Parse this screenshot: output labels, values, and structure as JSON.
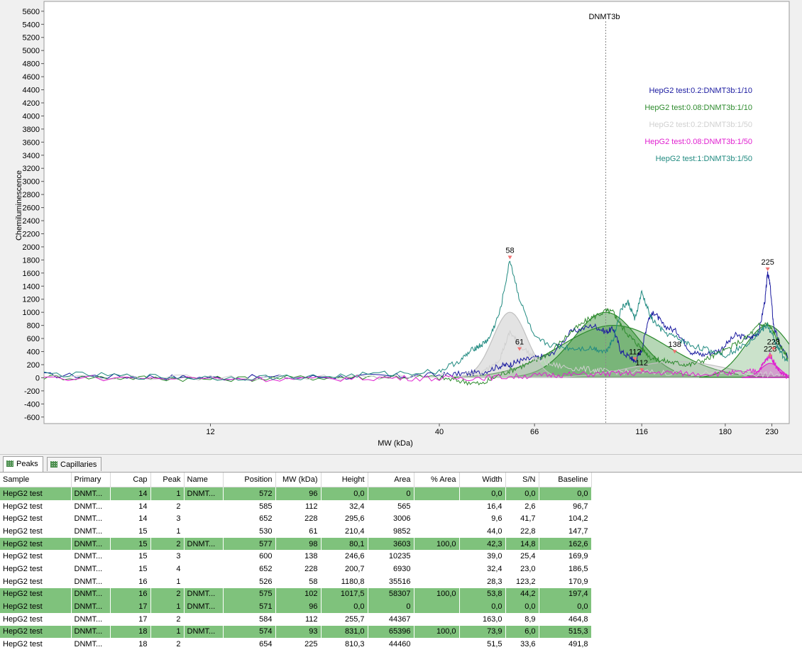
{
  "chart_data": {
    "type": "line",
    "xlabel": "MW (kDa)",
    "ylabel": "Chemiluminescence",
    "x_scale": "log",
    "ylim": [
      -700,
      5750
    ],
    "x_ticks": [
      12,
      40,
      66,
      116,
      180,
      230
    ],
    "y_ticks": [
      -600,
      -400,
      -200,
      0,
      200,
      400,
      600,
      800,
      1000,
      1200,
      1400,
      1600,
      1800,
      2000,
      2200,
      2400,
      2600,
      2800,
      3000,
      3200,
      3400,
      3600,
      3800,
      4000,
      4200,
      4400,
      4600,
      4800,
      5000,
      5200,
      5400,
      5600
    ],
    "marker": {
      "label": "DNMT3b",
      "x": 96
    },
    "legend_position": "right",
    "series": [
      {
        "name": "HepG2 test:0.2:DNMT3b:1/10",
        "color": "#1a1aa0",
        "x": [
          5,
          8,
          12,
          20,
          30,
          40,
          45,
          50,
          55,
          58,
          61,
          66,
          72,
          80,
          90,
          96,
          100,
          104,
          110,
          112,
          116,
          120,
          124,
          130,
          140,
          150,
          160,
          175,
          190,
          205,
          215,
          222,
          225,
          228,
          232,
          240,
          250
        ],
        "y": [
          40,
          20,
          0,
          10,
          20,
          40,
          60,
          80,
          180,
          200,
          260,
          300,
          350,
          700,
          800,
          700,
          750,
          400,
          300,
          250,
          420,
          900,
          1000,
          800,
          700,
          400,
          350,
          420,
          650,
          600,
          700,
          1200,
          1620,
          1400,
          800,
          500,
          300
        ]
      },
      {
        "name": "HepG2 test:0.08:DNMT3b:1/10",
        "color": "#2e8b2e",
        "x": [
          5,
          8,
          12,
          20,
          30,
          40,
          45,
          50,
          55,
          60,
          66,
          72,
          80,
          88,
          96,
          100,
          104,
          110,
          116,
          122,
          130,
          140,
          150,
          165,
          180,
          200,
          215,
          225,
          232,
          240,
          250
        ],
        "y": [
          10,
          0,
          -20,
          0,
          20,
          0,
          -50,
          -100,
          50,
          150,
          250,
          400,
          700,
          900,
          1020,
          1000,
          800,
          600,
          450,
          300,
          260,
          220,
          200,
          300,
          420,
          600,
          800,
          820,
          700,
          500,
          300
        ]
      },
      {
        "name": "HepG2 test:0.2:DNMT3b:1/50",
        "color": "#d0d0d0",
        "x": [
          5,
          12,
          20,
          30,
          40,
          50,
          55,
          58,
          61,
          66,
          72,
          80,
          90,
          96,
          110,
          130,
          160,
          200,
          225,
          250
        ],
        "y": [
          20,
          0,
          10,
          0,
          30,
          60,
          300,
          700,
          500,
          300,
          200,
          150,
          120,
          100,
          90,
          80,
          70,
          60,
          50,
          40
        ]
      },
      {
        "name": "HepG2 test:0.08:DNMT3b:1/50",
        "color": "#e020d0",
        "x": [
          5,
          12,
          20,
          30,
          40,
          50,
          60,
          70,
          80,
          96,
          110,
          130,
          150,
          180,
          200,
          215,
          222,
          228,
          234,
          242,
          250
        ],
        "y": [
          0,
          -10,
          -20,
          0,
          -10,
          0,
          20,
          40,
          50,
          60,
          70,
          80,
          60,
          70,
          80,
          120,
          250,
          350,
          200,
          60,
          20
        ]
      },
      {
        "name": "HepG2 test:1:DNMT3b:1/50",
        "color": "#208a80",
        "x": [
          5,
          8,
          12,
          20,
          30,
          40,
          45,
          48,
          50,
          52,
          55,
          58,
          61,
          66,
          72,
          80,
          90,
          96,
          100,
          104,
          108,
          112,
          116,
          122,
          130,
          140,
          150,
          165,
          180,
          200,
          215,
          225,
          232,
          240,
          250
        ],
        "y": [
          60,
          20,
          0,
          10,
          60,
          100,
          280,
          450,
          500,
          600,
          1000,
          1800,
          1200,
          600,
          500,
          450,
          450,
          400,
          600,
          1050,
          1150,
          900,
          1300,
          900,
          700,
          600,
          500,
          420,
          350,
          500,
          700,
          800,
          600,
          400,
          250
        ]
      }
    ],
    "peaks": [
      {
        "label": "58",
        "x": 58,
        "y": 1800
      },
      {
        "label": "61",
        "x": 61,
        "y": 400
      },
      {
        "label": "112",
        "x": 112,
        "y": 250
      },
      {
        "label": "112",
        "x": 116,
        "y": 80
      },
      {
        "label": "138",
        "x": 138,
        "y": 360
      },
      {
        "label": "225",
        "x": 225,
        "y": 1620
      },
      {
        "label": "228",
        "x": 228,
        "y": 290
      },
      {
        "label": "228",
        "x": 232,
        "y": 400
      }
    ],
    "fills": [
      {
        "color": "#2e8b2e",
        "opacity": 0.45,
        "center": 96,
        "height": 1000,
        "sigma": 0.17
      },
      {
        "color": "#2e8b2e",
        "opacity": 0.35,
        "center": 100,
        "height": 800,
        "sigma": 0.28
      },
      {
        "color": "#c0c0c0",
        "opacity": 0.45,
        "center": 58,
        "height": 1000,
        "sigma": 0.09
      },
      {
        "color": "#c0c0c0",
        "opacity": 0.35,
        "center": 140,
        "height": 250,
        "sigma": 0.25
      },
      {
        "color": "#2e8b2e",
        "opacity": 0.25,
        "center": 225,
        "height": 800,
        "sigma": 0.12
      },
      {
        "color": "#e020d0",
        "opacity": 0.35,
        "center": 228,
        "height": 220,
        "sigma": 0.05
      }
    ]
  },
  "tabs": [
    {
      "label": "Peaks"
    },
    {
      "label": "Capillaries"
    }
  ],
  "table": {
    "columns": [
      "Sample",
      "Primary",
      "Cap",
      "Peak",
      "Name",
      "Position",
      "MW (kDa)",
      "Height",
      "Area",
      "% Area",
      "Width",
      "S/N",
      "Baseline"
    ],
    "rows": [
      {
        "hl": true,
        "cells": [
          "HepG2 test",
          "DNMT...",
          "14",
          "1",
          "DNMT...",
          "572",
          "96",
          "0,0",
          "0",
          "",
          "0,0",
          "0,0",
          "0,0"
        ]
      },
      {
        "hl": false,
        "cells": [
          "HepG2 test",
          "DNMT...",
          "14",
          "2",
          "",
          "585",
          "112",
          "32,4",
          "565",
          "",
          "16,4",
          "2,6",
          "96,7"
        ]
      },
      {
        "hl": false,
        "cells": [
          "HepG2 test",
          "DNMT...",
          "14",
          "3",
          "",
          "652",
          "228",
          "295,6",
          "3006",
          "",
          "9,6",
          "41,7",
          "104,2"
        ]
      },
      {
        "hl": false,
        "cells": [
          "HepG2 test",
          "DNMT...",
          "15",
          "1",
          "",
          "530",
          "61",
          "210,4",
          "9852",
          "",
          "44,0",
          "22,8",
          "147,7"
        ]
      },
      {
        "hl": true,
        "cells": [
          "HepG2 test",
          "DNMT...",
          "15",
          "2",
          "DNMT...",
          "577",
          "98",
          "80,1",
          "3603",
          "100,0",
          "42,3",
          "14,8",
          "162,6"
        ]
      },
      {
        "hl": false,
        "cells": [
          "HepG2 test",
          "DNMT...",
          "15",
          "3",
          "",
          "600",
          "138",
          "246,6",
          "10235",
          "",
          "39,0",
          "25,4",
          "169,9"
        ]
      },
      {
        "hl": false,
        "cells": [
          "HepG2 test",
          "DNMT...",
          "15",
          "4",
          "",
          "652",
          "228",
          "200,7",
          "6930",
          "",
          "32,4",
          "23,0",
          "186,5"
        ]
      },
      {
        "hl": false,
        "cells": [
          "HepG2 test",
          "DNMT...",
          "16",
          "1",
          "",
          "526",
          "58",
          "1180,8",
          "35516",
          "",
          "28,3",
          "123,2",
          "170,9"
        ]
      },
      {
        "hl": true,
        "cells": [
          "HepG2 test",
          "DNMT...",
          "16",
          "2",
          "DNMT...",
          "575",
          "102",
          "1017,5",
          "58307",
          "100,0",
          "53,8",
          "44,2",
          "197,4"
        ]
      },
      {
        "hl": true,
        "cells": [
          "HepG2 test",
          "DNMT...",
          "17",
          "1",
          "DNMT...",
          "571",
          "96",
          "0,0",
          "0",
          "",
          "0,0",
          "0,0",
          "0,0"
        ]
      },
      {
        "hl": false,
        "cells": [
          "HepG2 test",
          "DNMT...",
          "17",
          "2",
          "",
          "584",
          "112",
          "255,7",
          "44367",
          "",
          "163,0",
          "8,9",
          "464,8"
        ]
      },
      {
        "hl": true,
        "cells": [
          "HepG2 test",
          "DNMT...",
          "18",
          "1",
          "DNMT...",
          "574",
          "93",
          "831,0",
          "65396",
          "100,0",
          "73,9",
          "6,0",
          "515,3"
        ]
      },
      {
        "hl": false,
        "cells": [
          "HepG2 test",
          "DNMT...",
          "18",
          "2",
          "",
          "654",
          "225",
          "810,3",
          "44460",
          "",
          "51,5",
          "33,6",
          "491,8"
        ]
      }
    ]
  }
}
